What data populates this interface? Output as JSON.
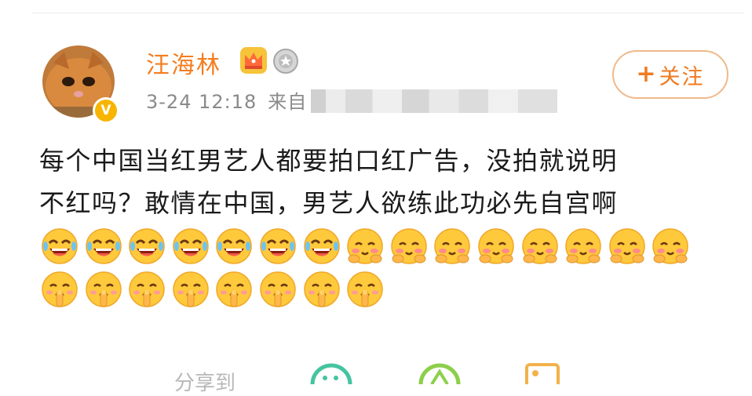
{
  "post": {
    "username": "汪海林",
    "timestamp": "3-24 12:18",
    "source_prefix": "来自",
    "follow_label": "关注",
    "text_line1": "每个中国当红男艺人都要拍口红广告，没拍就说明",
    "text_line2": "不红吗？敢情在中国，男艺人欲练此功必先自宫啊",
    "emojis": [
      {
        "name": "laugh-cry-emoji",
        "count": 7
      },
      {
        "name": "shy-blush-emoji",
        "count": 8
      },
      {
        "name": "finger-on-lips-emoji",
        "count": 8
      }
    ]
  },
  "share": {
    "label": "分享到",
    "targets": [
      "wechat-icon",
      "moments-icon",
      "image-icon"
    ]
  },
  "colors": {
    "username": "#f57d1f",
    "follow_border": "#f0b98a",
    "verified_badge": "#f7b500",
    "meta_text": "#8a8a8a"
  }
}
